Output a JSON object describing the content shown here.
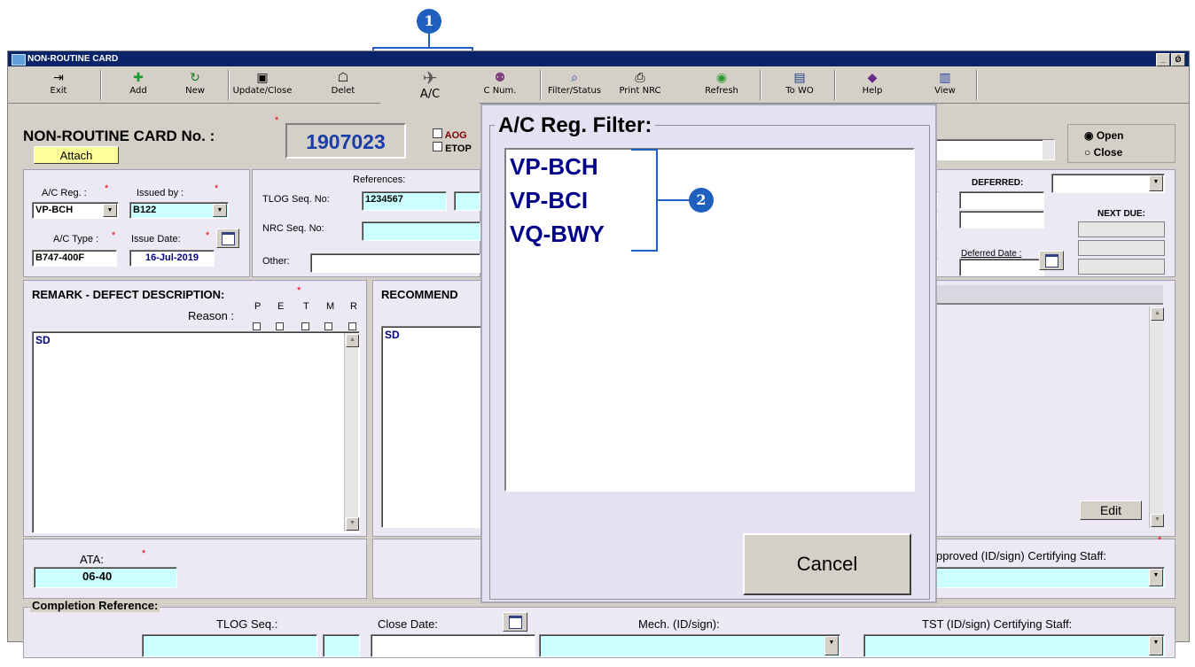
{
  "window": {
    "title": "NON-ROUTINE CARD",
    "win_buttons": [
      "_",
      "Ǿ"
    ]
  },
  "toolbar": {
    "buttons": [
      {
        "label": "Exit",
        "icon": "exit-icon",
        "glyph": "⇥"
      },
      {
        "label": "Add",
        "icon": "add-icon",
        "glyph": "✚"
      },
      {
        "label": "New",
        "icon": "new-icon",
        "glyph": "↻"
      },
      {
        "label": "Update/Close",
        "icon": "save-icon",
        "glyph": "▣"
      },
      {
        "label": "Delet",
        "icon": "trash-icon",
        "glyph": "☖"
      },
      {
        "label": "A/C",
        "icon": "airplane-icon",
        "glyph": "✈"
      },
      {
        "label": "C Num.",
        "icon": "search-person-icon",
        "glyph": "⚉"
      },
      {
        "label": "Filter/Status",
        "icon": "magnifier-icon",
        "glyph": "⌕"
      },
      {
        "label": "Print NRC",
        "icon": "printer-icon",
        "glyph": "⎙"
      },
      {
        "label": "Refresh",
        "icon": "refresh-icon",
        "glyph": "◉"
      },
      {
        "label": "To WO",
        "icon": "to-wo-icon",
        "glyph": "▤"
      },
      {
        "label": "Help",
        "icon": "help-icon",
        "glyph": "◆"
      },
      {
        "label": "View",
        "icon": "view-icon",
        "glyph": "▥"
      }
    ]
  },
  "header": {
    "card_no_label": "NON-ROUTINE CARD No. :",
    "card_no": "1907023",
    "attach": "Attach",
    "aog": "AOG",
    "etops": "ETOP",
    "status_options": [
      "Open",
      "Close"
    ],
    "status_selected": "Open"
  },
  "left_panel": {
    "ac_reg_label": "A/C Reg. :",
    "ac_reg": "VP-BCH",
    "issued_by_label": "Issued by :",
    "issued_by": "B122",
    "ac_type_label": "A/C Type :",
    "ac_type": "B747-400F",
    "issue_date_label": "Issue Date:",
    "issue_date": "16-Jul-2019"
  },
  "references": {
    "title": "References:",
    "tlog_label": "TLOG Seq. No:",
    "tlog": "1234567",
    "nrc_label": "NRC Seq. No:",
    "other_label": "Other:"
  },
  "deferred": {
    "deferred_label": "DEFERRED:",
    "next_due_label": "NEXT DUE:",
    "deferred_date_label": "Deferred Date :"
  },
  "remark": {
    "title": "REMARK - DEFECT DESCRIPTION:",
    "reason_label": "Reason :",
    "reason_codes": [
      "P",
      "E",
      "T",
      "M",
      "R"
    ],
    "text": "SD"
  },
  "recommend": {
    "title": "RECOMMEND",
    "text": "SD"
  },
  "right_area": {
    "edit": "Edit",
    "certifying_label": "pproved (ID/sign) Certifying Staff:"
  },
  "ata": {
    "label": "ATA:",
    "value": "06-40"
  },
  "completion": {
    "title": "Completion Reference:",
    "tlog_label": "TLOG Seq.:",
    "close_date_label": "Close Date:",
    "mech_label": "Mech. (ID/sign):",
    "tst_label": "TST (ID/sign) Certifying Staff:"
  },
  "dialog": {
    "title": "A/C Reg. Filter:",
    "items": [
      "VP-BCH",
      "VP-BCI",
      "VQ-BWY"
    ],
    "cancel": "Cancel"
  },
  "callouts": [
    "1",
    "2"
  ],
  "colors": {
    "accent": "#1f5fbf",
    "field_cyan": "#ccffff",
    "card_no": "#1a3ea8"
  }
}
